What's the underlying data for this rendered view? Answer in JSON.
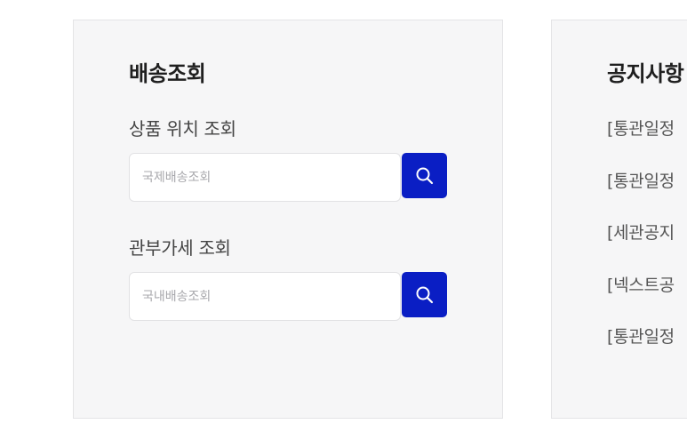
{
  "delivery": {
    "title": "배송조회",
    "product_lookup_label": "상품 위치 조회",
    "international_placeholder": "국제배송조회",
    "customs_lookup_label": "관부가세 조회",
    "domestic_placeholder": "국내배송조회"
  },
  "notices": {
    "title": "공지사항",
    "items": [
      "[통관일정",
      "[통관일정",
      "[세관공지",
      "[넥스트공",
      "[통관일정"
    ]
  },
  "colors": {
    "accent": "#0a1ec4",
    "panel_bg": "#f6f6f7"
  },
  "icons": {
    "search": "search-icon"
  }
}
